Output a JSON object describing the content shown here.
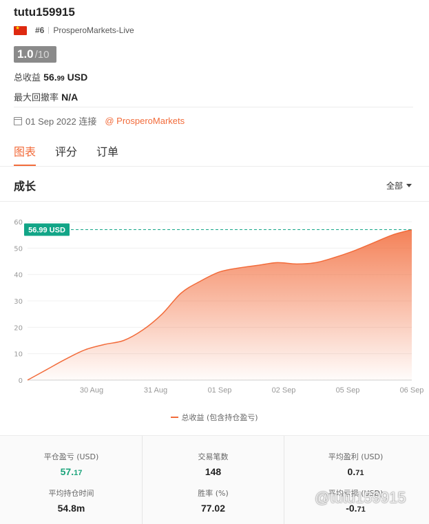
{
  "account": {
    "name": "tutu159915",
    "rank": "#6",
    "server": "ProsperoMarkets-Live",
    "score_main": "1.0",
    "score_suffix": "/10",
    "profit_label": "总收益",
    "profit_int": "56.",
    "profit_dec": "99",
    "profit_unit": "USD",
    "drawdown_label": "最大回撤率",
    "drawdown_value": "N/A",
    "connected_text": "01 Sep 2022 连接",
    "broker_link": "@ ProsperoMarkets"
  },
  "tabs": [
    {
      "label": "图表",
      "active": true
    },
    {
      "label": "评分",
      "active": false
    },
    {
      "label": "订单",
      "active": false
    }
  ],
  "section": {
    "title": "成长",
    "filter_value": "全部"
  },
  "chart_data": {
    "type": "area",
    "x_ticks": [
      "30 Aug",
      "31 Aug",
      "01 Sep",
      "02 Sep",
      "05 Sep",
      "06 Sep"
    ],
    "ylim": [
      0,
      60
    ],
    "y_ticks": [
      0,
      10,
      20,
      30,
      40,
      50,
      60
    ],
    "x": [
      0,
      0.3,
      0.6,
      0.9,
      1.2,
      1.5,
      1.8,
      2.1,
      2.4,
      2.7,
      3.0,
      3.3,
      3.6,
      3.9,
      4.2,
      4.5,
      4.8,
      5.1,
      5.4,
      5.7,
      6.0
    ],
    "values": [
      0,
      4,
      8,
      11.5,
      13.5,
      15,
      19,
      25,
      33,
      37.5,
      41,
      42.5,
      43.5,
      44.5,
      44,
      44.5,
      46.5,
      49,
      52,
      55,
      56.99
    ],
    "series": [
      {
        "name": "总收益 (包含持仓盈亏)"
      }
    ],
    "current_label": "56.99 USD",
    "current_value": 56.99,
    "grid": true,
    "legend_position": "bottom",
    "line_color": "#f26b3a",
    "marker_color": "#12a587"
  },
  "summary": {
    "closed_pl_label": "平仓盈亏 (USD)",
    "closed_pl_int": "57.",
    "closed_pl_dec": "17",
    "trades_label": "交易笔数",
    "trades_value": "148",
    "avg_profit_label": "平均盈利 (USD)",
    "avg_profit_int": "0.",
    "avg_profit_dec": "71",
    "avg_hold_label": "平均持仓时间",
    "avg_hold_value": "54.8m",
    "win_rate_label": "胜率 (%)",
    "win_rate_value": "77.02",
    "avg_loss_label": "平均亏损 (USD)",
    "avg_loss_int": "-0.",
    "avg_loss_dec": "71"
  },
  "watermark": "@tutu159915",
  "colors": {
    "accent": "#f26b3a",
    "green": "#1aa37a"
  }
}
